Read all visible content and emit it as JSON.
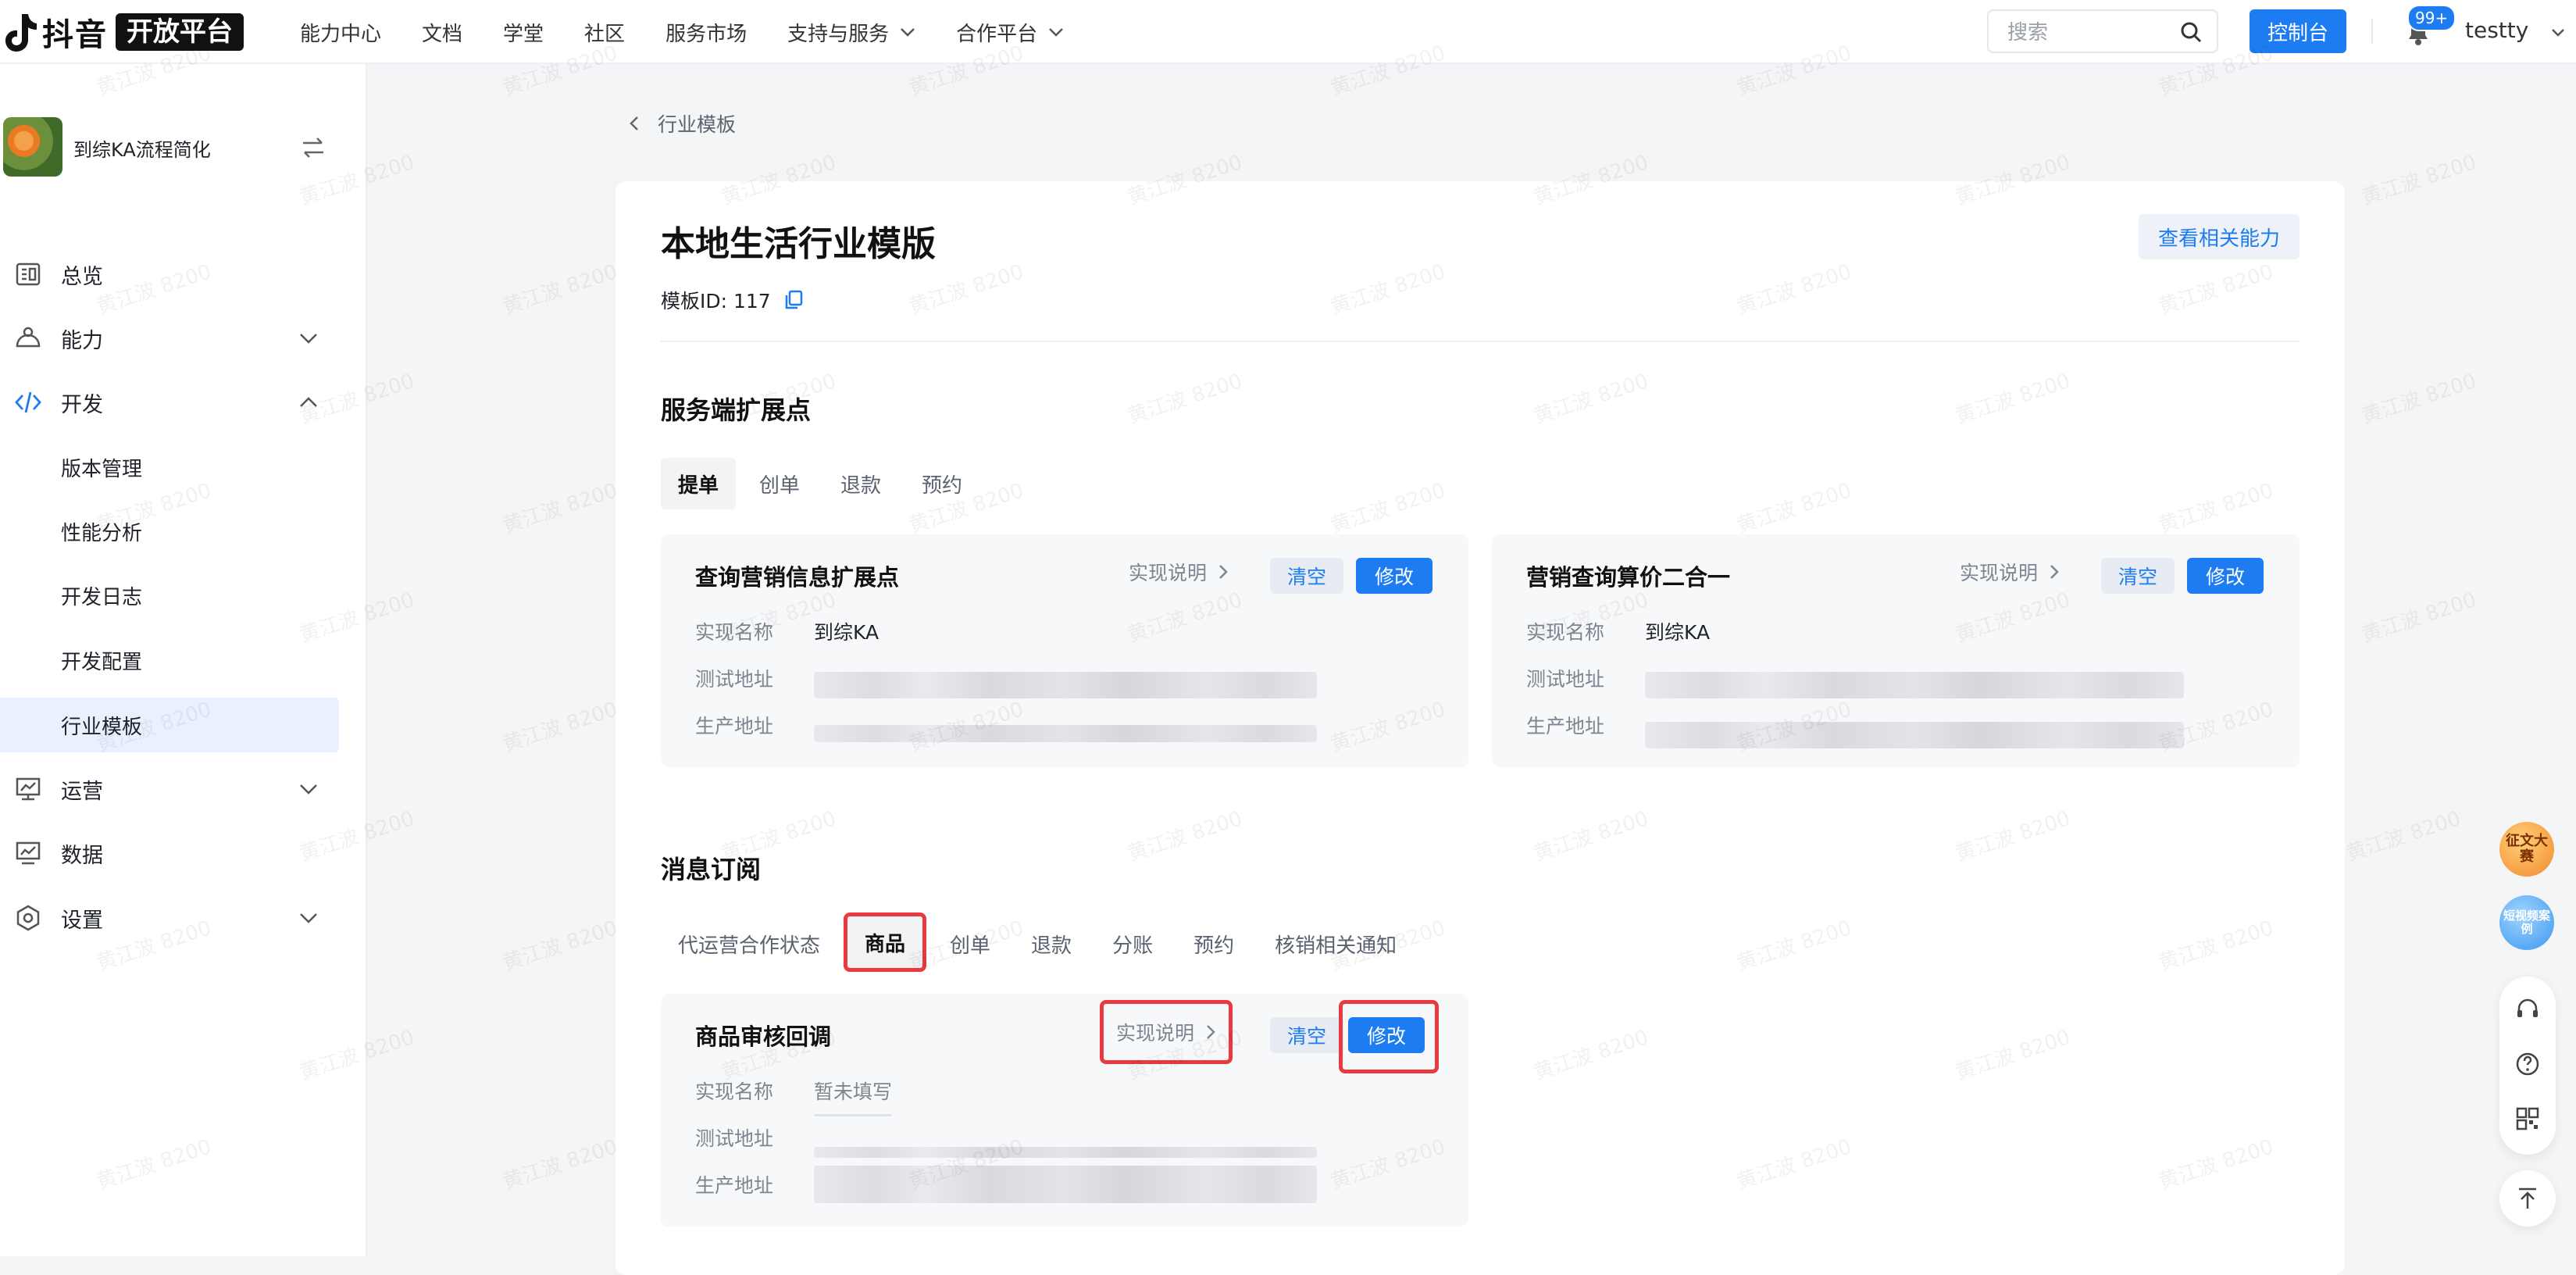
{
  "top_nav": {
    "brand": "抖音",
    "brand_badge": "开放平台",
    "links": [
      {
        "label": "能力中心",
        "dropdown": false
      },
      {
        "label": "文档",
        "dropdown": false
      },
      {
        "label": "学堂",
        "dropdown": false
      },
      {
        "label": "社区",
        "dropdown": false
      },
      {
        "label": "服务市场",
        "dropdown": false
      },
      {
        "label": "支持与服务",
        "dropdown": true
      },
      {
        "label": "合作平台",
        "dropdown": true
      }
    ],
    "search_placeholder": "搜索",
    "console_button": "控制台",
    "notification_count": "99+",
    "username": "testty"
  },
  "sidebar": {
    "app_name": "到综KA流程简化",
    "items": [
      {
        "label": "总览",
        "icon": "overview-icon",
        "chevron": null
      },
      {
        "label": "能力",
        "icon": "capability-icon",
        "chevron": "down"
      },
      {
        "label": "开发",
        "icon": "code-icon",
        "chevron": "up",
        "accent": "#1d7cf2"
      },
      {
        "label": "运营",
        "icon": "operation-icon",
        "chevron": "down"
      },
      {
        "label": "数据",
        "icon": "data-icon",
        "chevron": null
      },
      {
        "label": "设置",
        "icon": "settings-icon",
        "chevron": "down"
      }
    ],
    "dev_subitems": [
      {
        "label": "版本管理",
        "active": false
      },
      {
        "label": "性能分析",
        "active": false
      },
      {
        "label": "开发日志",
        "active": false
      },
      {
        "label": "开发配置",
        "active": false
      },
      {
        "label": "行业模板",
        "active": true
      }
    ]
  },
  "breadcrumb": {
    "label": "行业模板"
  },
  "page": {
    "title": "本地生活行业模版",
    "related_button": "查看相关能力",
    "template_id": "模板ID: 117"
  },
  "service_section": {
    "title": "服务端扩展点",
    "tabs": [
      {
        "label": "提单",
        "active": true
      },
      {
        "label": "创单",
        "active": false
      },
      {
        "label": "退款",
        "active": false
      },
      {
        "label": "预约",
        "active": false
      }
    ],
    "cards": [
      {
        "title": "查询营销信息扩展点",
        "impl_label": "实现说明",
        "clear": "清空",
        "edit": "修改",
        "rows": [
          {
            "label": "实现名称",
            "value": "到综KA"
          },
          {
            "label": "测试地址",
            "value": null
          },
          {
            "label": "生产地址",
            "value": null
          }
        ]
      },
      {
        "title": "营销查询算价二合一",
        "impl_label": "实现说明",
        "clear": "清空",
        "edit": "修改",
        "rows": [
          {
            "label": "实现名称",
            "value": "到综KA"
          },
          {
            "label": "测试地址",
            "value": null
          },
          {
            "label": "生产地址",
            "value": null
          }
        ]
      }
    ]
  },
  "message_section": {
    "title": "消息订阅",
    "tabs": [
      {
        "label": "代运营合作状态",
        "active": false
      },
      {
        "label": "商品",
        "active": true
      },
      {
        "label": "创单",
        "active": false
      },
      {
        "label": "退款",
        "active": false
      },
      {
        "label": "分账",
        "active": false
      },
      {
        "label": "预约",
        "active": false
      },
      {
        "label": "核销相关通知",
        "active": false
      }
    ],
    "card": {
      "title": "商品审核回调",
      "impl_label": "实现说明",
      "clear": "清空",
      "edit": "修改",
      "rows": [
        {
          "label": "实现名称",
          "value": "暂未填写"
        },
        {
          "label": "测试地址",
          "value": null
        },
        {
          "label": "生产地址",
          "value": null
        }
      ]
    }
  },
  "floating": {
    "contest_badge": "征文大赛",
    "case_badge": "短视频案例"
  },
  "watermark_text": "黄江波 8200",
  "colors": {
    "accent": "#1d7cf2",
    "highlight": "#e93a3f"
  }
}
